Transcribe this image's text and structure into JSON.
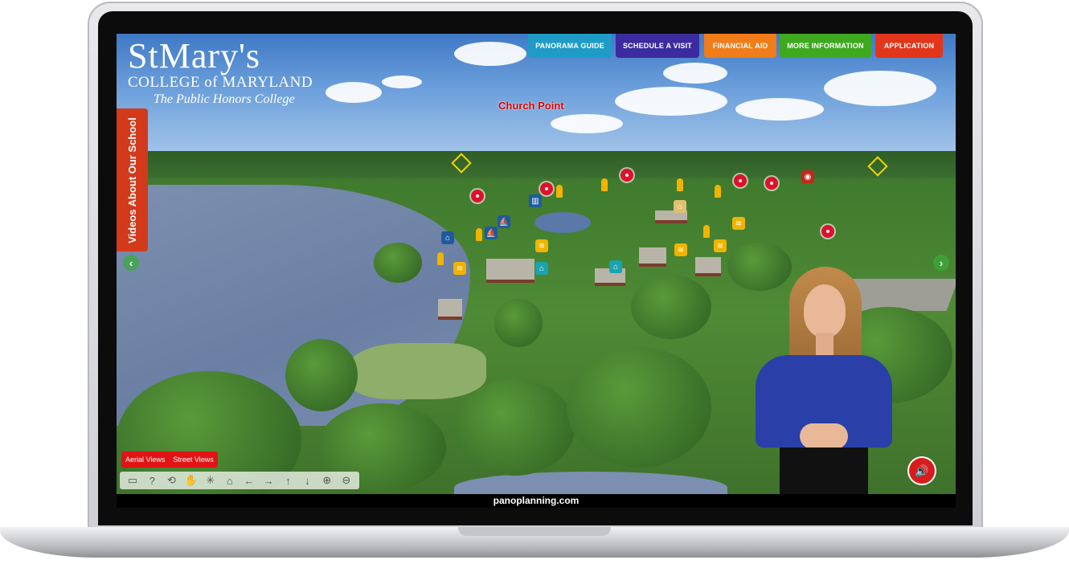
{
  "logo": {
    "name": "StMary's",
    "college": "COLLEGE of MARYLAND",
    "tagline": "The Public Honors College"
  },
  "nav": [
    {
      "label": "PANORAMA GUIDE",
      "color": "#1e9bc7"
    },
    {
      "label": "SCHEDULE A VISIT",
      "color": "#3b2b9e"
    },
    {
      "label": "FINANCIAL AID",
      "color": "#f07c1a"
    },
    {
      "label": "MORE INFORMATION",
      "color": "#3ea91f"
    },
    {
      "label": "APPLICATION",
      "color": "#e2361b"
    }
  ],
  "side_tab": {
    "label": "Videos About Our School"
  },
  "place_label": "Church Point",
  "view_tabs": [
    "Aerial Views",
    "Street Views"
  ],
  "toolbar_icons": [
    "screen-icon",
    "help-icon",
    "rotate-icon",
    "hand-icon",
    "gyro-icon",
    "home-icon",
    "arrow-left-icon",
    "arrow-right-icon",
    "arrow-up-icon",
    "arrow-down-icon",
    "zoom-in-icon",
    "zoom-out-icon"
  ],
  "toolbar_glyphs": [
    "▭",
    "?",
    "⟲",
    "✋",
    "✳",
    "⌂",
    "←",
    "→",
    "↑",
    "↓",
    "⊕",
    "⊖"
  ],
  "footer": "panoplanning.com",
  "sound_glyph": "🔊",
  "nav_prev_glyph": "‹",
  "nav_next_glyph": "›"
}
